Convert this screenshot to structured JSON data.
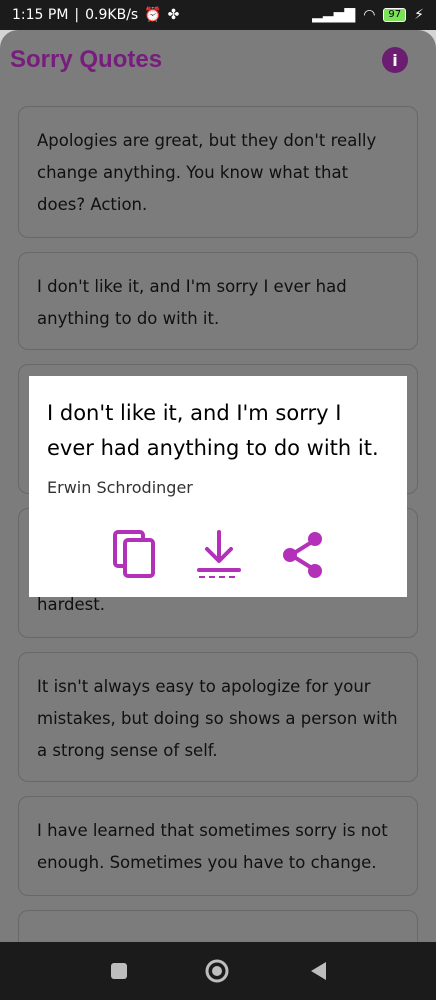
{
  "status_bar": {
    "time": "1:15 PM",
    "speed": "0.9KB/s",
    "battery": "97"
  },
  "app": {
    "title": "Sorry Quotes",
    "info_label": "i"
  },
  "quotes": [
    "Apologies are great, but they don't really change anything. You know what that does? Action.",
    "I don't like it, and I'm sorry I ever had anything to do with it.",
    "",
    "hardest.",
    "It isn't always easy to apologize for your mistakes, but doing so shows a person with a strong sense of self.",
    "I have learned that sometimes sorry is not enough. Sometimes you have to change."
  ],
  "dialog": {
    "quote": "I don't like it, and I'm sorry I ever had anything to do with it.",
    "author": "Erwin Schrodinger"
  },
  "colors": {
    "accent": "#b330b8",
    "title": "#7a1e80"
  }
}
